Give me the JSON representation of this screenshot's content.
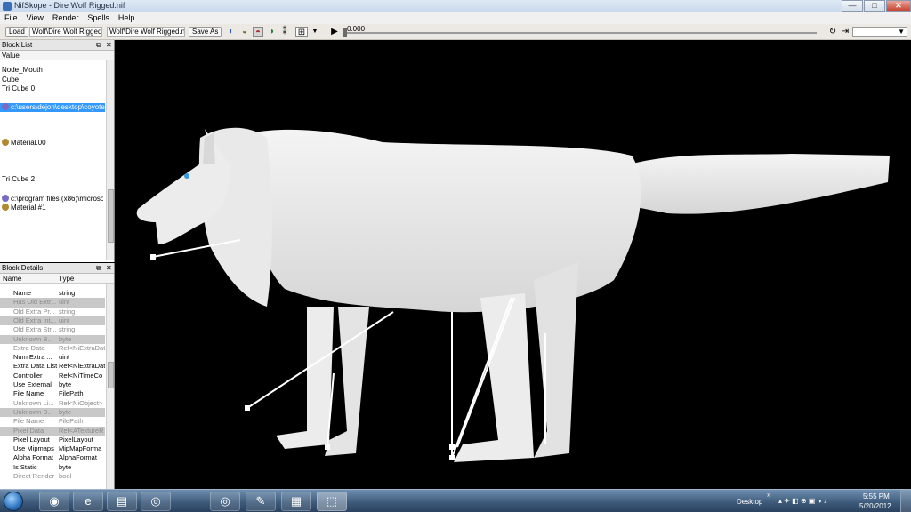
{
  "window": {
    "title": "NifSkope - Dire Wolf Rigged.nif",
    "min": "—",
    "max": "□",
    "close": "✕"
  },
  "menu": [
    "File",
    "View",
    "Render",
    "Spells",
    "Help"
  ],
  "toolbar": {
    "load": "Load",
    "load_path": "Wolf\\Dire Wolf Rigged.nif",
    "save_path": "Wolf\\Dire Wolf Rigged.nif",
    "save_as": "Save As",
    "time": "0.000"
  },
  "block_list": {
    "title": "Block List",
    "column": "Value",
    "rows": [
      {
        "text": "Node_Mouth",
        "icon": ""
      },
      {
        "text": "Cube",
        "icon": ""
      },
      {
        "text": "Tri Cube 0",
        "icon": ""
      },
      {
        "text": "c:\\users\\dejon\\desktop\\coyote",
        "icon": "texture-icon",
        "selected": true
      },
      {
        "text": "Material.00",
        "icon": "material-icon"
      },
      {
        "text": "Tri Cube 2",
        "icon": ""
      },
      {
        "text": "c:\\program files (x86)\\microsof",
        "icon": "texture-icon"
      },
      {
        "text": "Material #1",
        "icon": "material-icon"
      }
    ]
  },
  "block_details": {
    "title": "Block Details",
    "col_name": "Name",
    "col_type": "Type",
    "rows": [
      {
        "name": "Name",
        "type": "string",
        "state": "normal"
      },
      {
        "name": "Has Old Extr...",
        "type": "uint",
        "state": "grey"
      },
      {
        "name": "Old Extra Pr...",
        "type": "string",
        "state": "dim"
      },
      {
        "name": "Old Extra Int...",
        "type": "uint",
        "state": "grey"
      },
      {
        "name": "Old Extra Str...",
        "type": "string",
        "state": "dim"
      },
      {
        "name": "Unknown B...",
        "type": "byte",
        "state": "grey"
      },
      {
        "name": "Extra Data",
        "type": "Ref<NiExtraDat",
        "state": "dim"
      },
      {
        "name": "Num Extra ...",
        "type": "uint",
        "state": "normal"
      },
      {
        "name": "Extra Data List",
        "type": "Ref<NiExtraDat",
        "state": "normal"
      },
      {
        "name": "Controller",
        "type": "Ref<NiTimeCo",
        "state": "normal"
      },
      {
        "name": "Use External",
        "type": "byte",
        "state": "normal"
      },
      {
        "name": "File Name",
        "type": "FilePath",
        "state": "normal"
      },
      {
        "name": "Unknown Li...",
        "type": "Ref<NiObject>",
        "state": "dim"
      },
      {
        "name": "Unknown B...",
        "type": "byte",
        "state": "grey"
      },
      {
        "name": "File Name",
        "type": "FilePath",
        "state": "dim"
      },
      {
        "name": "Pixel Data",
        "type": "Ref<ATextureR",
        "state": "grey"
      },
      {
        "name": "Pixel Layout",
        "type": "PixelLayout",
        "state": "normal"
      },
      {
        "name": "Use Mipmaps",
        "type": "MipMapForma",
        "state": "normal"
      },
      {
        "name": "Alpha Format",
        "type": "AlphaFormat",
        "state": "normal"
      },
      {
        "name": "Is Static",
        "type": "byte",
        "state": "normal"
      },
      {
        "name": "Direct Render",
        "type": "bool",
        "state": "dim"
      }
    ]
  },
  "taskbar": {
    "desktop_label": "Desktop",
    "time": "5:55 PM",
    "date": "5/20/2012",
    "apps": [
      "media-player-icon",
      "ie-icon",
      "explorer-icon",
      "chrome-icon",
      "paint-icon",
      "media-icon",
      "nifskope-icon"
    ]
  }
}
